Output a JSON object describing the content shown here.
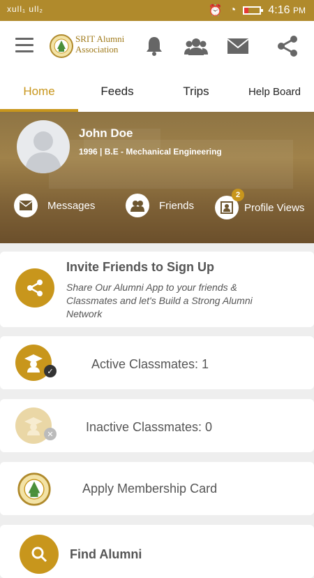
{
  "status_bar": {
    "left": "xull₁ ull₂",
    "time": "4:16",
    "ampm": "PM"
  },
  "app": {
    "logo_line1": "SRIT Alumni",
    "logo_line2": "Association"
  },
  "tabs": [
    {
      "label": "Home"
    },
    {
      "label": "Feeds"
    },
    {
      "label": "Trips"
    },
    {
      "label": "Help Board"
    }
  ],
  "profile": {
    "name": "John Doe",
    "details": "1996 | B.E - Mechanical Engineering"
  },
  "quick_links": {
    "messages": "Messages",
    "friends": "Friends",
    "profile_views": "Profile Views",
    "profile_views_count": "2"
  },
  "invite": {
    "title": "Invite Friends to Sign Up",
    "text": "Share Our Alumni App to your friends & Classmates and let's Build a Strong Alumni Network"
  },
  "active": {
    "label": "Active Classmates: 1"
  },
  "inactive": {
    "label": "Inactive Classmates: 0"
  },
  "membership": {
    "label": "Apply Membership Card"
  },
  "find": {
    "label": "Find Alumni"
  },
  "colors": {
    "primary": "#c8961c",
    "status_bar": "#b08a2c"
  }
}
